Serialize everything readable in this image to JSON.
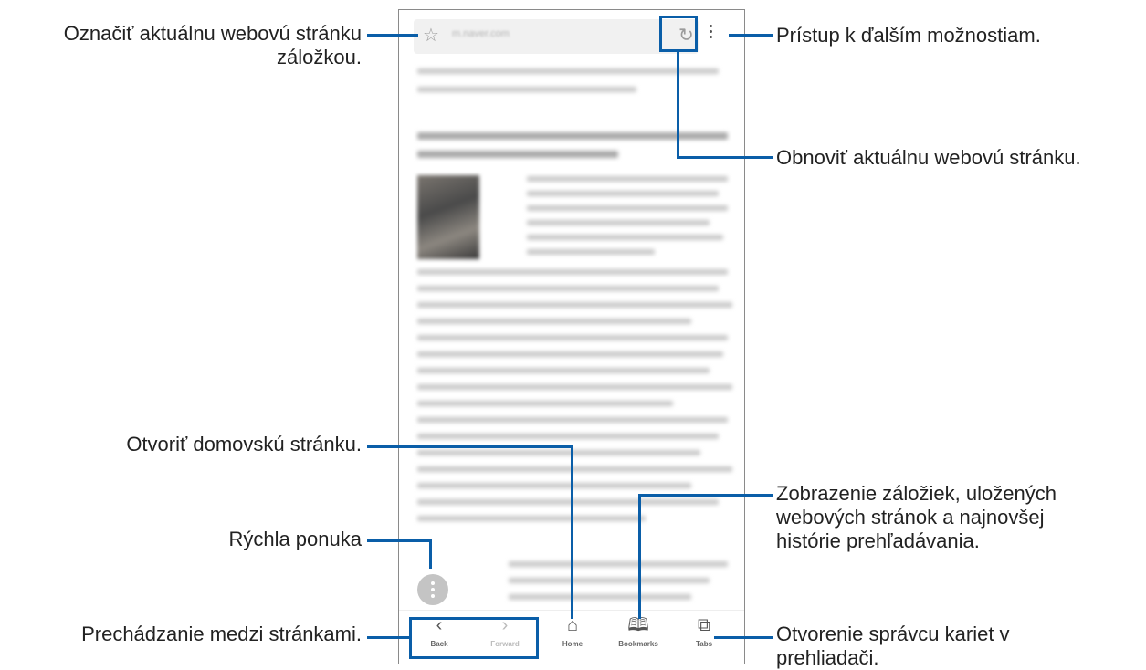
{
  "callouts": {
    "bookmark_line1": "Označiť aktuálnu webovú stránku",
    "bookmark_line2": "záložkou.",
    "more_options": "Prístup k ďalším možnostiam.",
    "refresh": "Obnoviť aktuálnu webovú stránku.",
    "home": "Otvoriť domovskú stránku.",
    "bookmarks_line1": "Zobrazenie záložiek, uložených",
    "bookmarks_line2": "webových stránok a najnovšej",
    "bookmarks_line3": "histórie prehľadávania.",
    "quick_menu": "Rýchla ponuka",
    "navigate": "Prechádzanie medzi stránkami.",
    "tabs_line1": "Otvorenie správcu kariet v",
    "tabs_line2": "prehliadači."
  },
  "browser": {
    "url": "m.naver.com",
    "nav": {
      "back": "Back",
      "forward": "Forward",
      "home": "Home",
      "bookmarks": "Bookmarks",
      "tabs": "Tabs"
    }
  },
  "colors": {
    "callout_line": "#0a5ea8"
  }
}
